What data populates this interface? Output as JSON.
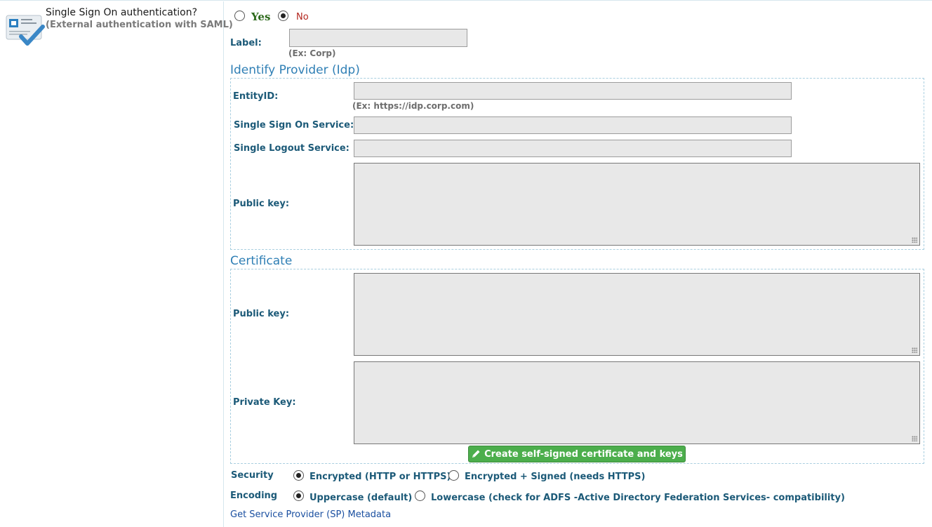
{
  "sso": {
    "title": "Single Sign On authentication?",
    "subtitle": "(External authentication with SAML)",
    "icon": "sso-card-check-icon",
    "yes_label": "Yes",
    "no_label": "No",
    "selected": "No"
  },
  "label_field": {
    "label": "Label:",
    "value": "",
    "hint": "(Ex: Corp)"
  },
  "idp": {
    "heading": "Identify Provider (Idp)",
    "entity_id": {
      "label": "EntityID:",
      "value": "",
      "hint": "(Ex: https://idp.corp.com)"
    },
    "sso_service": {
      "label": "Single Sign On Service:",
      "value": ""
    },
    "slo_service": {
      "label": "Single Logout Service:",
      "value": ""
    },
    "public_key": {
      "label": "Public key:",
      "value": ""
    }
  },
  "certificate": {
    "heading": "Certificate",
    "public_key": {
      "label": "Public key:",
      "value": ""
    },
    "private_key": {
      "label": "Private Key:",
      "value": ""
    },
    "create_button": "Create self-signed certificate and keys",
    "create_icon": "pencil-icon"
  },
  "security": {
    "label": "Security",
    "options": [
      "Encrypted (HTTP or HTTPS)",
      "Encrypted + Signed (needs HTTPS)"
    ],
    "selected": "Encrypted (HTTP or HTTPS)"
  },
  "encoding": {
    "label": "Encoding",
    "options": [
      "Uppercase (default)",
      "Lowercase (check for ADFS -Active Directory Federation Services- compatibility)"
    ],
    "selected": "Uppercase (default)"
  },
  "metadata_link": "Get Service Provider (SP) Metadata",
  "colors": {
    "label_blue": "#1c5a78",
    "section_blue": "#2f7fb5",
    "button_green": "#4cae4c",
    "yes_green": "#2d6a1c",
    "no_red": "#b3261e"
  }
}
